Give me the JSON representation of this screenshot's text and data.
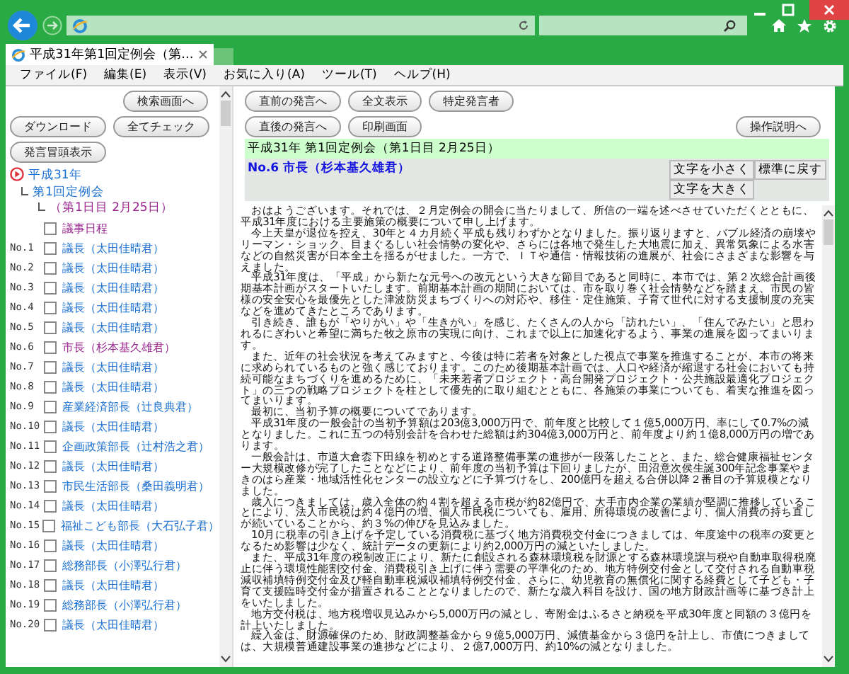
{
  "browser": {
    "tab_title": "平成31年第1回定例会（第...",
    "menu": [
      "ファイル(F)",
      "編集(E)",
      "表示(V)",
      "お気に入り(A)",
      "ツール(T)",
      "ヘルプ(H)"
    ]
  },
  "sidebar": {
    "buttons_top": [
      "検索画面へ"
    ],
    "buttons_row": [
      "ダウンロード",
      "全てチェック"
    ],
    "buttons_bottom": [
      "発言冒頭表示"
    ],
    "tree": {
      "label": "平成31年",
      "children": [
        {
          "label": "第1回定例会",
          "children": [
            {
              "label": "（第1日目 2月25日）"
            }
          ]
        }
      ]
    },
    "items": [
      {
        "label": "議事日程",
        "visited": true,
        "checked": false
      },
      {
        "no": "No.1",
        "label": "議長（太田佳晴君）",
        "visited": false,
        "checked": false
      },
      {
        "no": "No.2",
        "label": "議長（太田佳晴君）",
        "visited": false,
        "checked": false
      },
      {
        "no": "No.3",
        "label": "議長（太田佳晴君）",
        "visited": false,
        "checked": false
      },
      {
        "no": "No.4",
        "label": "議長（太田佳晴君）",
        "visited": false,
        "checked": false
      },
      {
        "no": "No.5",
        "label": "議長（太田佳晴君）",
        "visited": false,
        "checked": false
      },
      {
        "no": "No.6",
        "label": "市長（杉本基久雄君）",
        "visited": true,
        "checked": false
      },
      {
        "no": "No.7",
        "label": "議長（太田佳晴君）",
        "visited": false,
        "checked": false
      },
      {
        "no": "No.8",
        "label": "議長（太田佳晴君）",
        "visited": false,
        "checked": false
      },
      {
        "no": "No.9",
        "label": "産業経済部長（辻良典君）",
        "visited": false,
        "checked": false
      },
      {
        "no": "No.10",
        "label": "議長（太田佳晴君）",
        "visited": false,
        "checked": false
      },
      {
        "no": "No.11",
        "label": "企画政策部長（辻村浩之君）",
        "visited": false,
        "checked": false
      },
      {
        "no": "No.12",
        "label": "議長（太田佳晴君）",
        "visited": false,
        "checked": false
      },
      {
        "no": "No.13",
        "label": "市民生活部長（桑田義明君）",
        "visited": false,
        "checked": false
      },
      {
        "no": "No.14",
        "label": "議長（太田佳晴君）",
        "visited": false,
        "checked": false
      },
      {
        "no": "No.15",
        "label": "福祉こども部長（大石弘子君）",
        "visited": false,
        "checked": false
      },
      {
        "no": "No.16",
        "label": "議長（太田佳晴君）",
        "visited": false,
        "checked": false
      },
      {
        "no": "No.17",
        "label": "総務部長（小澤弘行君）",
        "visited": false,
        "checked": false
      },
      {
        "no": "No.18",
        "label": "議長（太田佳晴君）",
        "visited": false,
        "checked": false
      },
      {
        "no": "No.19",
        "label": "総務部長（小澤弘行君）",
        "visited": false,
        "checked": false
      },
      {
        "no": "No.20",
        "label": "議長（太田佳晴君）",
        "visited": false,
        "checked": false
      }
    ]
  },
  "main": {
    "buttons_row1": [
      "直前の発言へ",
      "全文表示",
      "特定発言者"
    ],
    "buttons_row2": [
      "直後の発言へ",
      "印刷画面"
    ],
    "help_button": "操作説明へ",
    "session_header": "平成31年 第1回定例会（第1日目 2月25日）",
    "speaker": "No.6 市長（杉本基久雄君）",
    "font_buttons": [
      "文字を小さく",
      "標準に戻す",
      "文字を大きく"
    ],
    "paragraphs": [
      "おはようございます。それでは、２月定例会の開会に当たりまして、所信の一端を述べさせていただくとともに、平成31年度における主要施策の概要について申し上げます。",
      "今上天皇が退位を控え、30年と４カ月続く平成も残りわずかとなりました。振り返りますと、バブル経済の崩壊やリーマン・ショック、目まぐるしい社会情勢の変化や、さらには各地で発生した大地震に加え、異常気象による水害などの自然災害が日本全土を揺るがせました。一方で、ＩＴや通信・情報技術の進展が、社会にさまざまな影響を与えました。",
      "平成31年度は、「平成」から新たな元号への改元という大きな節目であると同時に、本市では、第２次総合計画後期基本計画がスタートいたします。前期基本計画の期間においては、市を取り巻く社会情勢などを踏まえ、市民の皆様の安全安心を最優先とした津波防災まちづくりへの対応や、移住・定住施策、子育て世代に対する支援制度の充実などを進めてきたところであります。",
      "引き続き、誰もが「やりがい」や「生きがい」を感じ、たくさんの人から「訪れたい」、「住んでみたい」と思われるにぎわいと希望に満ちた牧之原市の実現に向け、これまで以上に加速化するよう、事業の進展を図ってまいります。",
      "また、近年の社会状況を考えてみますと、今後は特に若者を対象とした視点で事業を推進することが、本市の将来に求められているものと強く感じております。このため後期基本計画では、人口や経済が縮退する社会においても持続可能なまちづくりを進めるために、「未来若者プロジェクト・高台開発プロジェクト・公共施設最適化プロジェクト」の三つの戦略プロジェクトを柱として優先的に取り組むとともに、各施策の事業についても、着実な推進を図ってまいります。",
      "最初に、当初予算の概要についてであります。",
      "平成31年度の一般会計の当初予算額は203億3,000万円で、前年度と比較して１億5,000万円、率にして0.7%の減となりました。これに五つの特別会計を合わせた総額は約304億3,000万円と、前年度より約１億8,000万円の増であります。",
      "一般会計は、市道大倉枩下田線を初めとする道路整備事業の進捗が一段落したことと、また、総合健康福祉センター大規模改修が完了したことなどにより、前年度の当初予算は下回りましたが、田沼意次侯生誕300年記念事業やまきのはら産業・地域活性化センターの設立などに予算づけをし、200億円を超える合併以降２番目の予算規模となりました。",
      "歳入につきましては、歳入全体の約４割を超える市税が約82億円で、大手市内企業の業績が堅調に推移していることにより、法人市民税は約４億円の増、個人市民税についても、雇用、所得環境の改善により、個人消費の持ち直しが続いていることから、約３%の伸びを見込みました。",
      "10月に税率の引き上げを予定している消費税に基づく地方消費税交付金につきましては、年度途中の税率の変更となるため影響は少なく、統計データの更新により約2,000万円の減といたしました。",
      "また、平成31年度の税制改正により、新たに創設される森林環境税を財源とする森林環境譲与税や自動車取得税廃止に伴う環境性能割交付金、消費税引き上げに伴う需要の平準化のため、地方特例交付金として交付される自動車税減収補填特例交付金及び軽自動車税減収補填特例交付金、さらに、幼児教育の無償化に関する経費として子ども・子育て支援臨時交付金が措置されることとなりましたので、新たな歳入科目を設け、国の地方財政計画等に基づき計上をいたしました。",
      "地方交付税は、地方税増収見込みから5,000万円の減とし、寄附金はふるさと納税を平成30年度と同額の３億円を計上いたしました。",
      "繰入金は、財源確保のため、財政調整基金から９億5,000万円、減債基金から３億円を計上し、市債につきましては、大規模普通建設事業の進捗などにより、２億7,000万円、約10%の減となりました。"
    ]
  }
}
